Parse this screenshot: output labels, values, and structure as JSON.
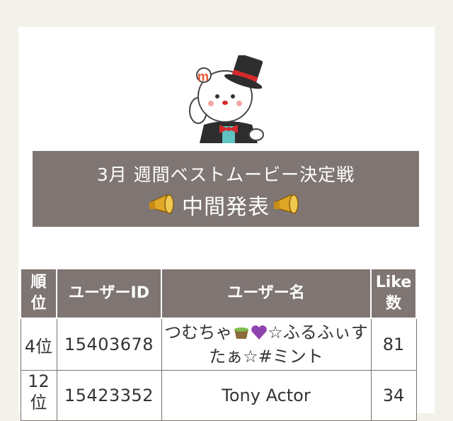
{
  "banner": {
    "line1": "3月 週間ベストムービー決定戦",
    "line2": "中間発表"
  },
  "table": {
    "headers": {
      "rank": "順位",
      "user_id": "ユーザーID",
      "user_name": "ユーザー名",
      "likes": "Like数"
    },
    "rows": [
      {
        "rank": "4位",
        "user_id": "15403678",
        "name_part1": "つむちゃ",
        "name_part2": "☆ふるふぃすたぁ☆#ミント",
        "likes": "81"
      },
      {
        "rank": "12位",
        "user_id": "15423352",
        "user_name": "Tony Actor",
        "likes": "34"
      }
    ]
  },
  "icons": [
    "mascot-bear-icon",
    "megaphone-icon",
    "green-tea-icon",
    "purple-heart-icon"
  ],
  "colors": {
    "banner_bg": "#7f7674",
    "user_id": "#e49b17",
    "page_bg": "#f3f2ea"
  }
}
